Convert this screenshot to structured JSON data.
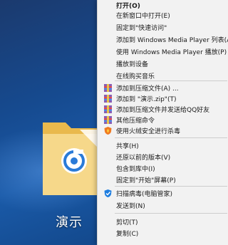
{
  "desktop": {
    "folder_label": "演示"
  },
  "context_menu": {
    "items": [
      {
        "label": "打开(O)"
      },
      {
        "label": "在新窗口中打开(E)"
      },
      {
        "label": "固定到\"快速访问\""
      },
      {
        "label": "添加到 Windows Media Player 列表(A)"
      },
      {
        "label": "使用 Windows Media Player 播放(P)"
      },
      {
        "label": "播放到设备"
      },
      {
        "label": "在线购买音乐"
      },
      {
        "label": "添加到压缩文件(A) ..."
      },
      {
        "label": "添加到 \"演示.zip\"(T)"
      },
      {
        "label": "添加到压缩文件并发送给QQ好友"
      },
      {
        "label": "其他压缩命令"
      },
      {
        "label": "使用火绒安全进行杀毒"
      },
      {
        "label": "共享(H)"
      },
      {
        "label": "还原以前的版本(V)"
      },
      {
        "label": "包含到库中(I)"
      },
      {
        "label": "固定到\"开始\"屏幕(P)"
      },
      {
        "label": "扫描病毒(电脑管家)"
      },
      {
        "label": "发送到(N)"
      },
      {
        "label": "剪切(T)"
      },
      {
        "label": "复制(C)"
      }
    ]
  },
  "icons": {
    "archive": "archive-icon",
    "huorong": "huorong-shield-icon",
    "tencent": "tencent-pc-manager-icon",
    "folder": "folder-icon"
  },
  "colors": {
    "menu_bg": "#f2f2f2",
    "desktop_blue": "#1a5aa8",
    "folder_yellow": "#f4d27a"
  }
}
